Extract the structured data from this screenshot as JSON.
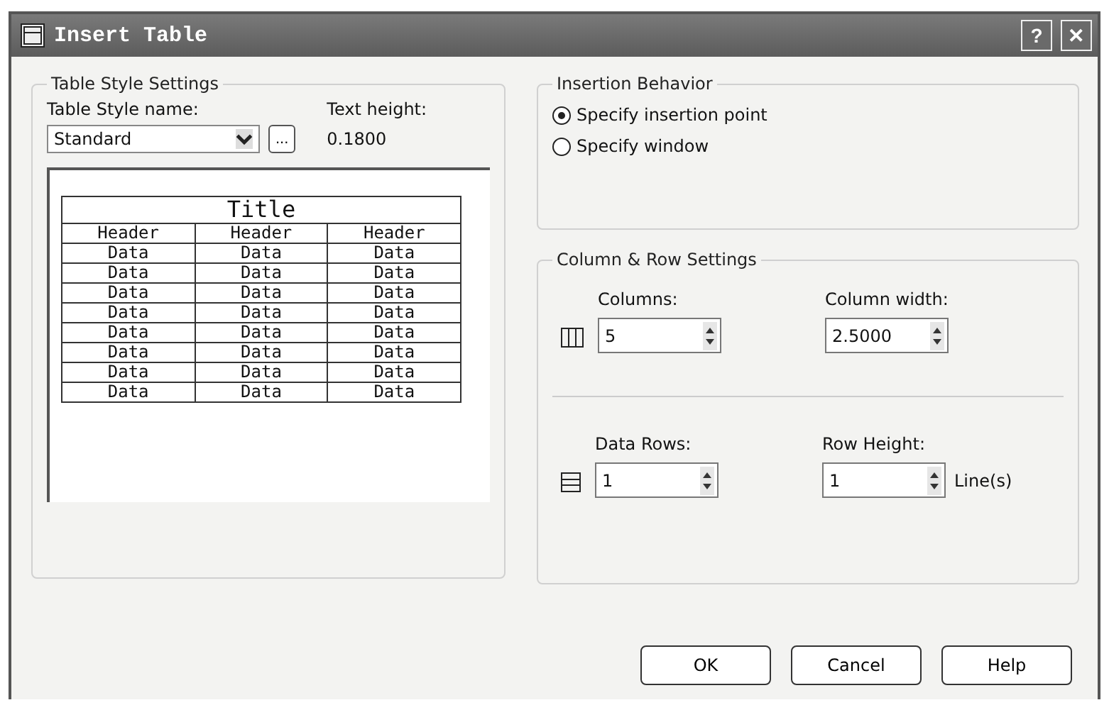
{
  "window": {
    "title": "Insert Table",
    "help_glyph": "?",
    "close_glyph": "✕"
  },
  "table_style_settings": {
    "legend": "Table Style Settings",
    "style_label": "Table Style name:",
    "style_value": "Standard",
    "browse_label": "...",
    "text_height_label": "Text height:",
    "text_height_value": "0.1800",
    "preview": {
      "title": "Title",
      "headers": [
        "Header",
        "Header",
        "Header"
      ],
      "rows": [
        [
          "Data",
          "Data",
          "Data"
        ],
        [
          "Data",
          "Data",
          "Data"
        ],
        [
          "Data",
          "Data",
          "Data"
        ],
        [
          "Data",
          "Data",
          "Data"
        ],
        [
          "Data",
          "Data",
          "Data"
        ],
        [
          "Data",
          "Data",
          "Data"
        ],
        [
          "Data",
          "Data",
          "Data"
        ],
        [
          "Data",
          "Data",
          "Data"
        ]
      ]
    }
  },
  "insertion_behavior": {
    "legend": "Insertion Behavior",
    "options": [
      {
        "label": "Specify insertion point",
        "selected": true
      },
      {
        "label": "Specify window",
        "selected": false
      }
    ]
  },
  "column_row_settings": {
    "legend": "Column & Row Settings",
    "columns": {
      "label": "Columns:",
      "value": "5"
    },
    "column_width": {
      "label": "Column width:",
      "value": "2.5000"
    },
    "data_rows": {
      "label": "Data Rows:",
      "value": "1"
    },
    "row_height": {
      "label": "Row Height:",
      "value": "1",
      "unit": "Line(s)"
    }
  },
  "buttons": [
    "OK",
    "Cancel",
    "Help"
  ]
}
